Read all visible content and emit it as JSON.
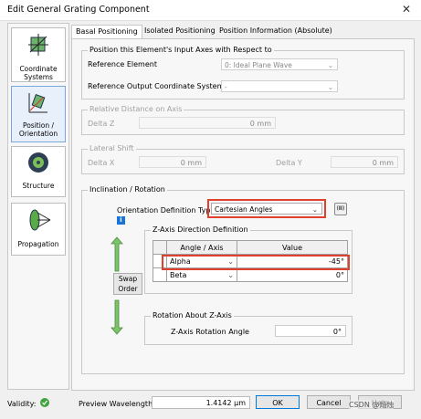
{
  "window": {
    "title": "Edit General Grating Component",
    "close": "✕"
  },
  "nav": [
    {
      "label1": "Coordinate",
      "label2": "Systems"
    },
    {
      "label1": "Position /",
      "label2": "Orientation"
    },
    {
      "label1": "Structure",
      "label2": ""
    },
    {
      "label1": "Propagation",
      "label2": ""
    }
  ],
  "tabs": [
    "Basal Positioning",
    "Isolated Positioning",
    "Position Information (Absolute)"
  ],
  "input_axes": {
    "title": "Position this Element's Input Axes with Respect to",
    "ref_element_label": "Reference Element",
    "ref_element_value": "0: Ideal Plane Wave",
    "ref_output_label": "Reference Output Coordinate System",
    "ref_output_value": "-"
  },
  "relative_distance": {
    "title": "Relative Distance on Axis",
    "delta_z_label": "Delta Z",
    "delta_z_value": "0 mm"
  },
  "lateral_shift": {
    "title": "Lateral Shift",
    "delta_x_label": "Delta X",
    "delta_x_value": "0 mm",
    "delta_y_label": "Delta Y",
    "delta_y_value": "0 mm"
  },
  "inclination": {
    "title": "Inclination / Rotation",
    "odt_label": "Orientation Definition Type",
    "odt_value": "Cartesian Angles",
    "info": "i",
    "zaxis_title": "Z-Axis Direction Definition",
    "col_angle": "Angle / Axis",
    "col_value": "Value",
    "rows": [
      {
        "axis": "Alpha",
        "value": "-45°"
      },
      {
        "axis": "Beta",
        "value": "0°"
      }
    ],
    "swap_label1": "Swap",
    "swap_label2": "Order",
    "rot_title": "Rotation About Z-Axis",
    "rot_label": "Z-Axis Rotation Angle",
    "rot_value": "0°"
  },
  "bottom": {
    "validity_label": "Validity:",
    "wavelength_label": "Preview Wavelength",
    "wavelength_value": "1.4142 µm",
    "ok": "OK",
    "cancel": "Cancel",
    "help": "Help",
    "watermark": "CSDN @灿烛"
  }
}
